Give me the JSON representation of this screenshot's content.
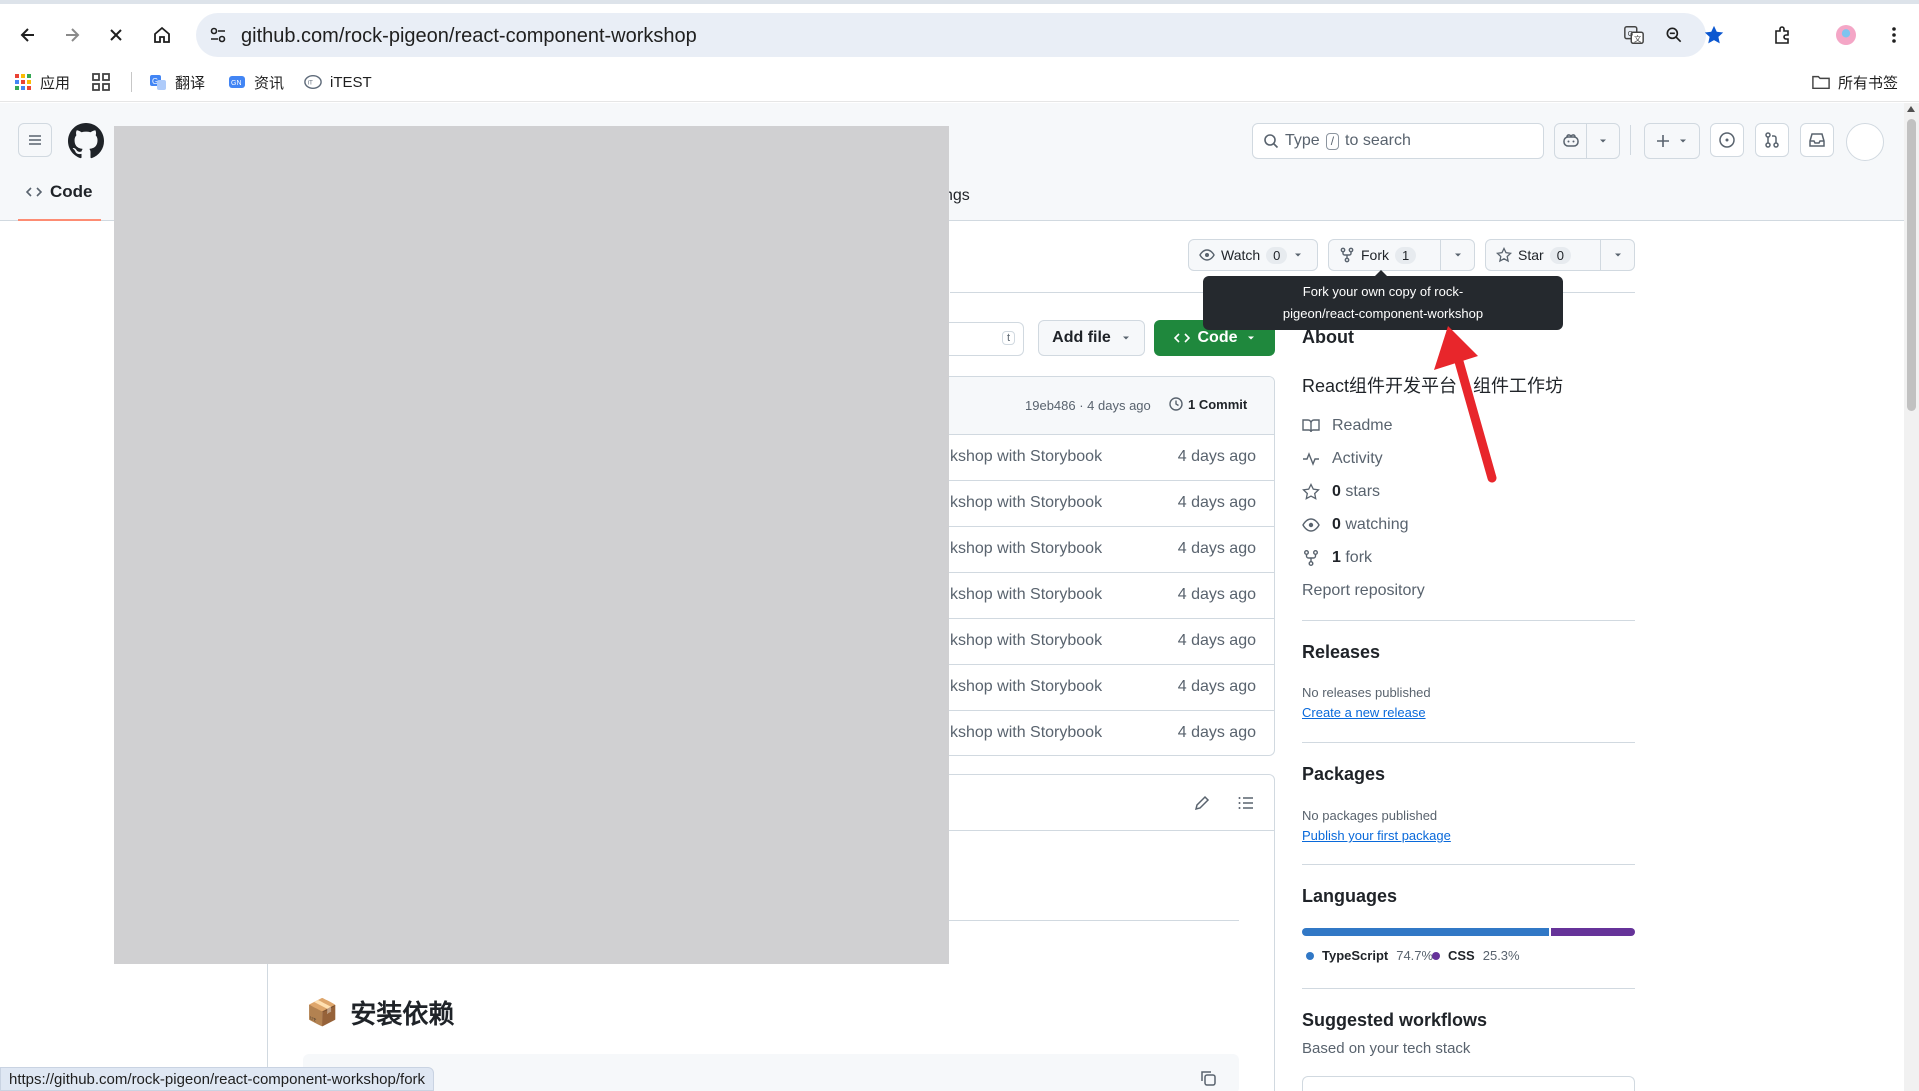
{
  "browser": {
    "url": "github.com/rock-pigeon/react-component-workshop",
    "status_url": "https://github.com/rock-pigeon/react-component-workshop/fork",
    "bookmarks": [
      {
        "label": "应用",
        "icon": "apps-grid-icon"
      },
      {
        "label": "",
        "icon": "grid-icon"
      },
      {
        "label": "翻译",
        "icon": "translate-icon"
      },
      {
        "label": "资讯",
        "icon": "news-icon"
      },
      {
        "label": "iTEST",
        "icon": "itest-icon"
      }
    ],
    "all_bookmarks_label": "所有书签"
  },
  "github": {
    "search_placeholder_pre": "Type",
    "search_key": "/",
    "search_placeholder_post": "to search",
    "tab_code": "Code",
    "tab_settings_fragment": "ngs"
  },
  "repo_actions": {
    "watch": {
      "label": "Watch",
      "count": "0"
    },
    "fork": {
      "label": "Fork",
      "count": "1"
    },
    "star": {
      "label": "Star",
      "count": "0"
    },
    "tooltip_line1": "Fork your own copy of rock-",
    "tooltip_line2": "pigeon/react-component-workshop"
  },
  "file_browser": {
    "goto_key": "t",
    "add_file": "Add file",
    "code": "Code",
    "commit_meta": "19eb486 · 4 days ago",
    "commits_label": "1 Commit",
    "rows": [
      {
        "message": "kshop with Storybook",
        "age": "4 days ago"
      },
      {
        "message": "kshop with Storybook",
        "age": "4 days ago"
      },
      {
        "message": "kshop with Storybook",
        "age": "4 days ago"
      },
      {
        "message": "kshop with Storybook",
        "age": "4 days ago"
      },
      {
        "message": "kshop with Storybook",
        "age": "4 days ago"
      },
      {
        "message": "kshop with Storybook",
        "age": "4 days ago"
      },
      {
        "message": "kshop with Storybook",
        "age": "4 days ago"
      }
    ]
  },
  "readme": {
    "heading_emoji": "📦",
    "heading": "安装依赖"
  },
  "sidebar": {
    "about": "About",
    "description": "React组件开发平台 - 组件工作坊",
    "readme": "Readme",
    "activity": "Activity",
    "stars_count": "0",
    "stars_label": "stars",
    "watching_count": "0",
    "watching_label": "watching",
    "fork_count": "1",
    "fork_label": "fork",
    "report": "Report repository",
    "releases": "Releases",
    "no_releases": "No releases published",
    "create_release": "Create a new release",
    "packages": "Packages",
    "no_packages": "No packages published",
    "publish_package": "Publish your first package",
    "languages": "Languages",
    "lang": [
      {
        "name": "TypeScript",
        "pct": "74.7%",
        "value": 74.7,
        "color": "#3178c6"
      },
      {
        "name": "CSS",
        "pct": "25.3%",
        "value": 25.3,
        "color": "#663399"
      }
    ],
    "suggested": "Suggested workflows",
    "suggested_sub": "Based on your tech stack"
  },
  "colors": {
    "accent_green": "#1f883d",
    "link_blue": "#0969da",
    "annotation_red": "#e8262b"
  }
}
